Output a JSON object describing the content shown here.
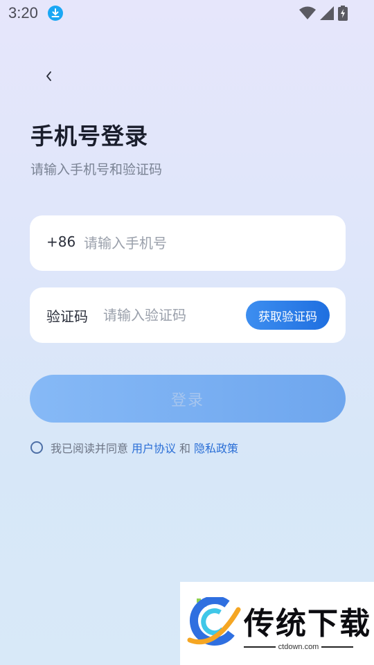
{
  "status_bar": {
    "time": "3:20",
    "icons": [
      "download-badge-icon",
      "wifi-icon",
      "signal-icon",
      "battery-charging-icon"
    ]
  },
  "header": {
    "back_icon": "chevron-left-icon",
    "title": "手机号登录",
    "subtitle": "请输入手机号和验证码"
  },
  "phone_input": {
    "prefix": "+86",
    "value": "",
    "placeholder": "请输入手机号"
  },
  "code_input": {
    "label": "验证码",
    "value": "",
    "placeholder": "请输入验证码",
    "button_label": "获取验证码"
  },
  "login_button": {
    "label": "登录",
    "enabled": false
  },
  "agreement": {
    "checked": false,
    "prefix_text": "我已阅读并同意",
    "user_agreement": "用户协议",
    "conjunction": "和",
    "privacy_policy": "隐私政策"
  },
  "watermark": {
    "name": "传统下载",
    "url": "ctdown.com"
  },
  "colors": {
    "primary": "#1f6fe0",
    "link": "#2b6fd6",
    "login_disabled": "#7cb0f3",
    "status_download": "#1aa7f4"
  }
}
